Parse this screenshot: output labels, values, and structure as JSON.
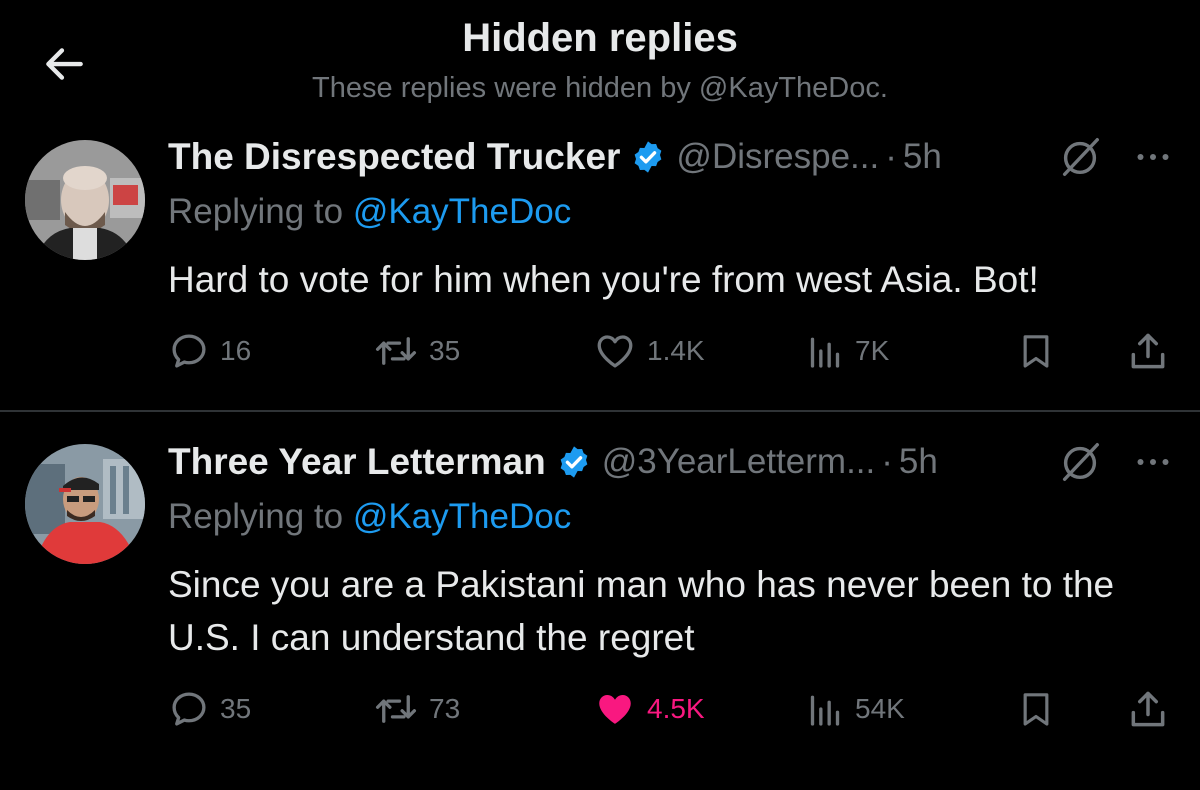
{
  "header": {
    "title": "Hidden replies",
    "subtitle": "These replies were hidden by @KayTheDoc."
  },
  "tweets": [
    {
      "display_name": "The Disrespected Trucker",
      "handle": "@Disrespe...",
      "separator": "·",
      "time": "5h",
      "replying_prefix": "Replying to ",
      "replying_to": "@KayTheDoc",
      "text": "Hard to vote for him when you're from west Asia. Bot!",
      "replies": "16",
      "retweets": "35",
      "likes": "1.4K",
      "views": "7K",
      "liked": false
    },
    {
      "display_name": "Three Year Letterman",
      "handle": "@3YearLetterm...",
      "separator": "·",
      "time": "5h",
      "replying_prefix": "Replying to ",
      "replying_to": "@KayTheDoc",
      "text": "Since you are a Pakistani man who has never been to the U.S. I can understand the regret",
      "replies": "35",
      "retweets": "73",
      "likes": "4.5K",
      "views": "54K",
      "liked": true
    }
  ],
  "colors": {
    "background": "#000000",
    "text_primary": "#e7e9ea",
    "text_secondary": "#71767b",
    "link": "#1d9bf0",
    "verified": "#1d9bf0",
    "like_active": "#f91880",
    "divider": "#2f3336"
  },
  "icons": {
    "back": "arrow-left-icon",
    "verified": "verified-badge-icon",
    "hidden": "hidden-reply-icon",
    "more": "more-dots-icon",
    "reply": "reply-bubble-icon",
    "retweet": "retweet-icon",
    "like": "heart-icon",
    "views": "views-bars-icon",
    "bookmark": "bookmark-icon",
    "share": "share-icon"
  }
}
